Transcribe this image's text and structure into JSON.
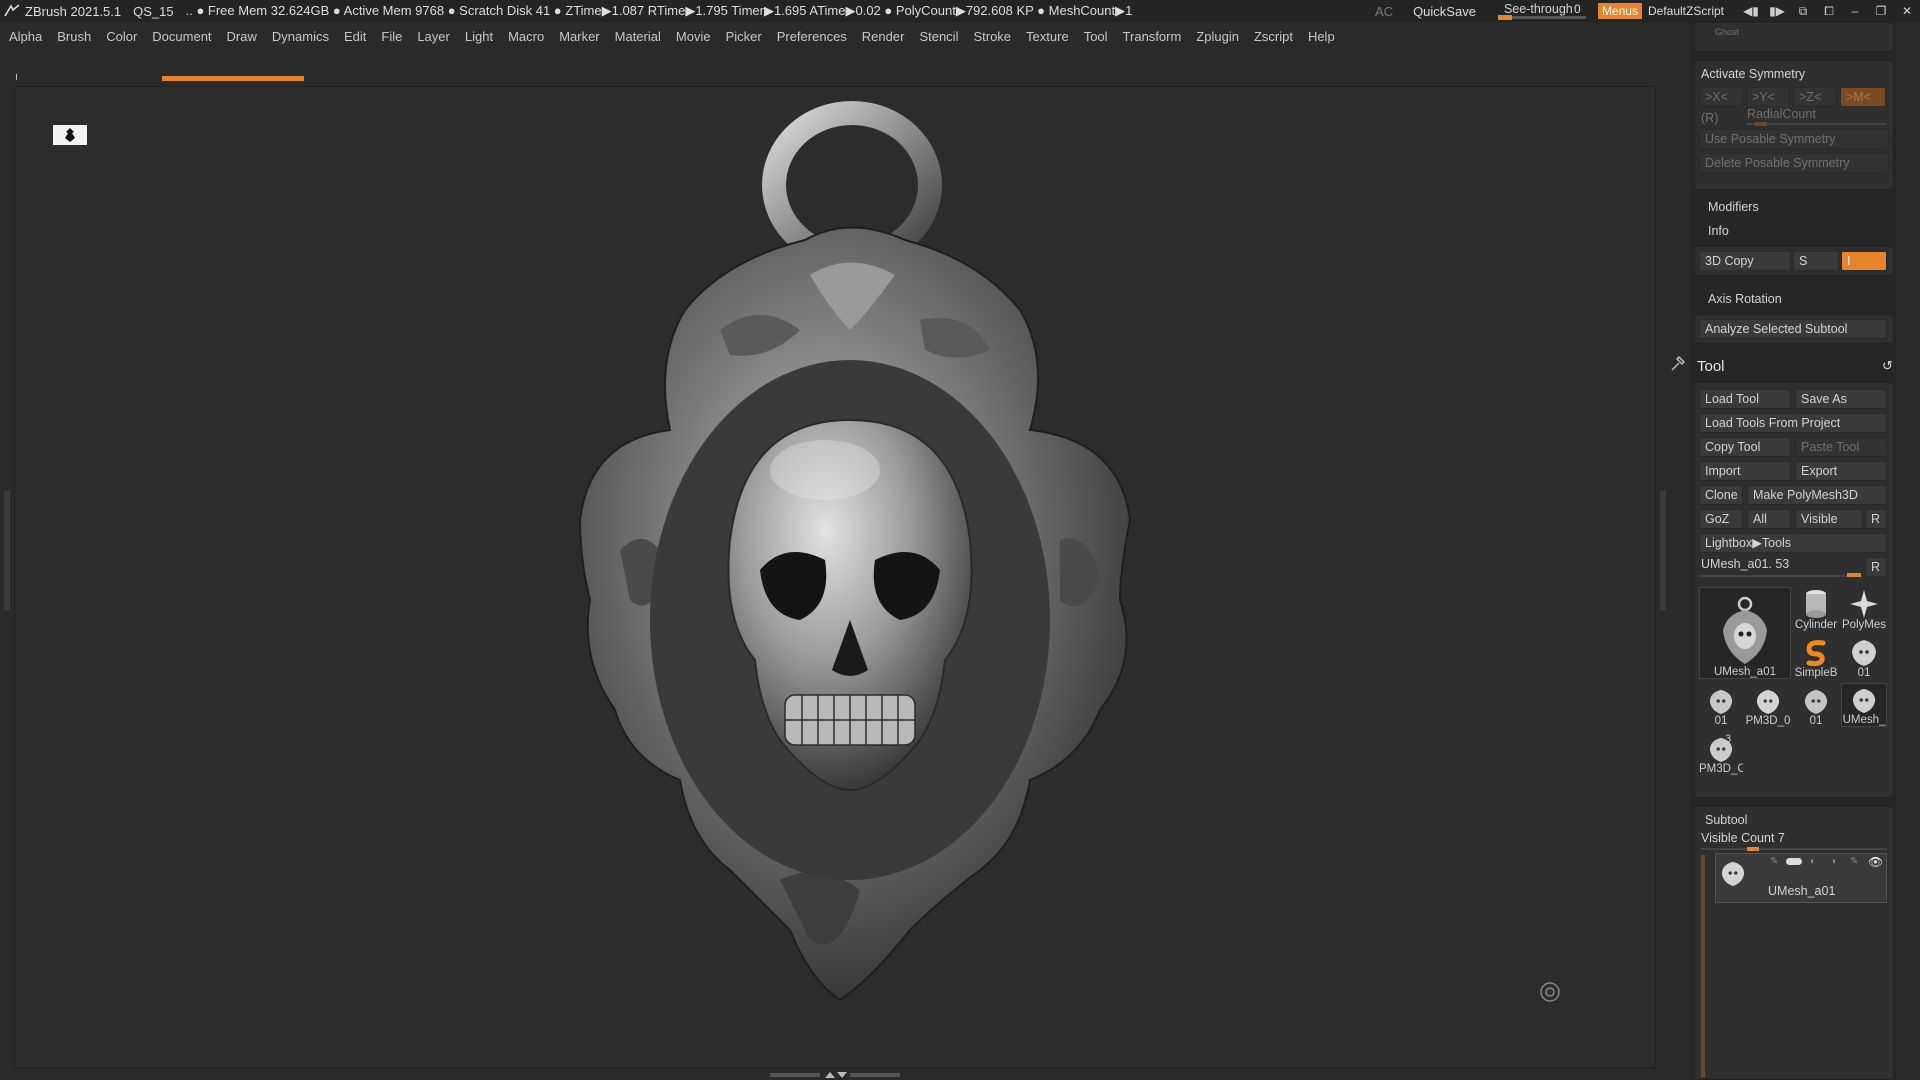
{
  "titlebar": {
    "app": "ZBrush 2021.5.1",
    "document": "QS_15",
    "stats": ".. ● Free Mem 32.624GB ● Active Mem 9768 ● Scratch Disk 41 ● ZTime▶1.087 RTime▶1.795 Timer▶1.695 ATime▶0.02 ● PolyCount▶792.608 KP ● MeshCount▶1",
    "ac": "AC",
    "quicksave": "QuickSave",
    "see_through_label": "See-through",
    "see_through_value": "0",
    "menus": "Menus",
    "default_script": "DefaultZScript"
  },
  "menubar": [
    "Alpha",
    "Brush",
    "Color",
    "Document",
    "Draw",
    "Dynamics",
    "Edit",
    "File",
    "Layer",
    "Light",
    "Macro",
    "Marker",
    "Material",
    "Movie",
    "Picker",
    "Preferences",
    "Render",
    "Stencil",
    "Stroke",
    "Texture",
    "Tool",
    "Transform",
    "Zplugin",
    "Zscript",
    "Help"
  ],
  "panel": {
    "ghost": "Ghost",
    "symmetry": {
      "title": "Activate Symmetry",
      "x": ">X<",
      "y": ">Y<",
      "z": ">Z<",
      "m": ">M<",
      "r": "(R)",
      "radial": "RadialCount",
      "use_posable": "Use Posable Symmetry",
      "delete_posable": "Delete Posable Symmetry"
    },
    "modifiers": "Modifiers",
    "info": "Info",
    "copy3d": "3D Copy",
    "copy_s": "S",
    "copy_i": "I",
    "axis_rotation": "Axis Rotation",
    "analyze": "Analyze Selected Subtool",
    "tool": {
      "title": "Tool",
      "load_tool": "Load Tool",
      "save_as": "Save As",
      "load_from_project": "Load Tools From Project",
      "copy_tool": "Copy Tool",
      "paste_tool": "Paste Tool",
      "import": "Import",
      "export": "Export",
      "clone": "Clone",
      "make_polymesh": "Make PolyMesh3D",
      "goz": "GoZ",
      "all": "All",
      "visible": "Visible",
      "r": "R",
      "lightbox": "Lightbox▶Tools",
      "current": "UMesh_a01. 53",
      "current_r": "R",
      "thumbs": [
        {
          "caption": "UMesh_a01",
          "icon": "pendant-icon"
        },
        {
          "caption": "Cylinder",
          "icon": "cylinder-icon"
        },
        {
          "caption": "PolyMes",
          "icon": "star-icon"
        },
        {
          "caption": "SimpleB",
          "icon": "simple-brush-icon"
        },
        {
          "caption": "01",
          "icon": "pendant-icon"
        },
        {
          "caption": "01",
          "icon": "pendant-icon"
        },
        {
          "caption": "PM3D_0",
          "icon": "pendant-icon"
        },
        {
          "caption": "01",
          "icon": "pendant-icon"
        },
        {
          "caption": "UMesh_",
          "icon": "pendant-icon"
        },
        {
          "caption": "PM3D_C",
          "icon": "pendant-icon"
        },
        {
          "caption": "3",
          "icon": ""
        }
      ]
    },
    "subtool": {
      "title": "Subtool",
      "visible_count": "Visible Count 7",
      "item": "UMesh_a01"
    }
  },
  "colors": {
    "accent": "#e8852a",
    "background": "#2a2a2a",
    "panel": "#2f2f2f"
  }
}
